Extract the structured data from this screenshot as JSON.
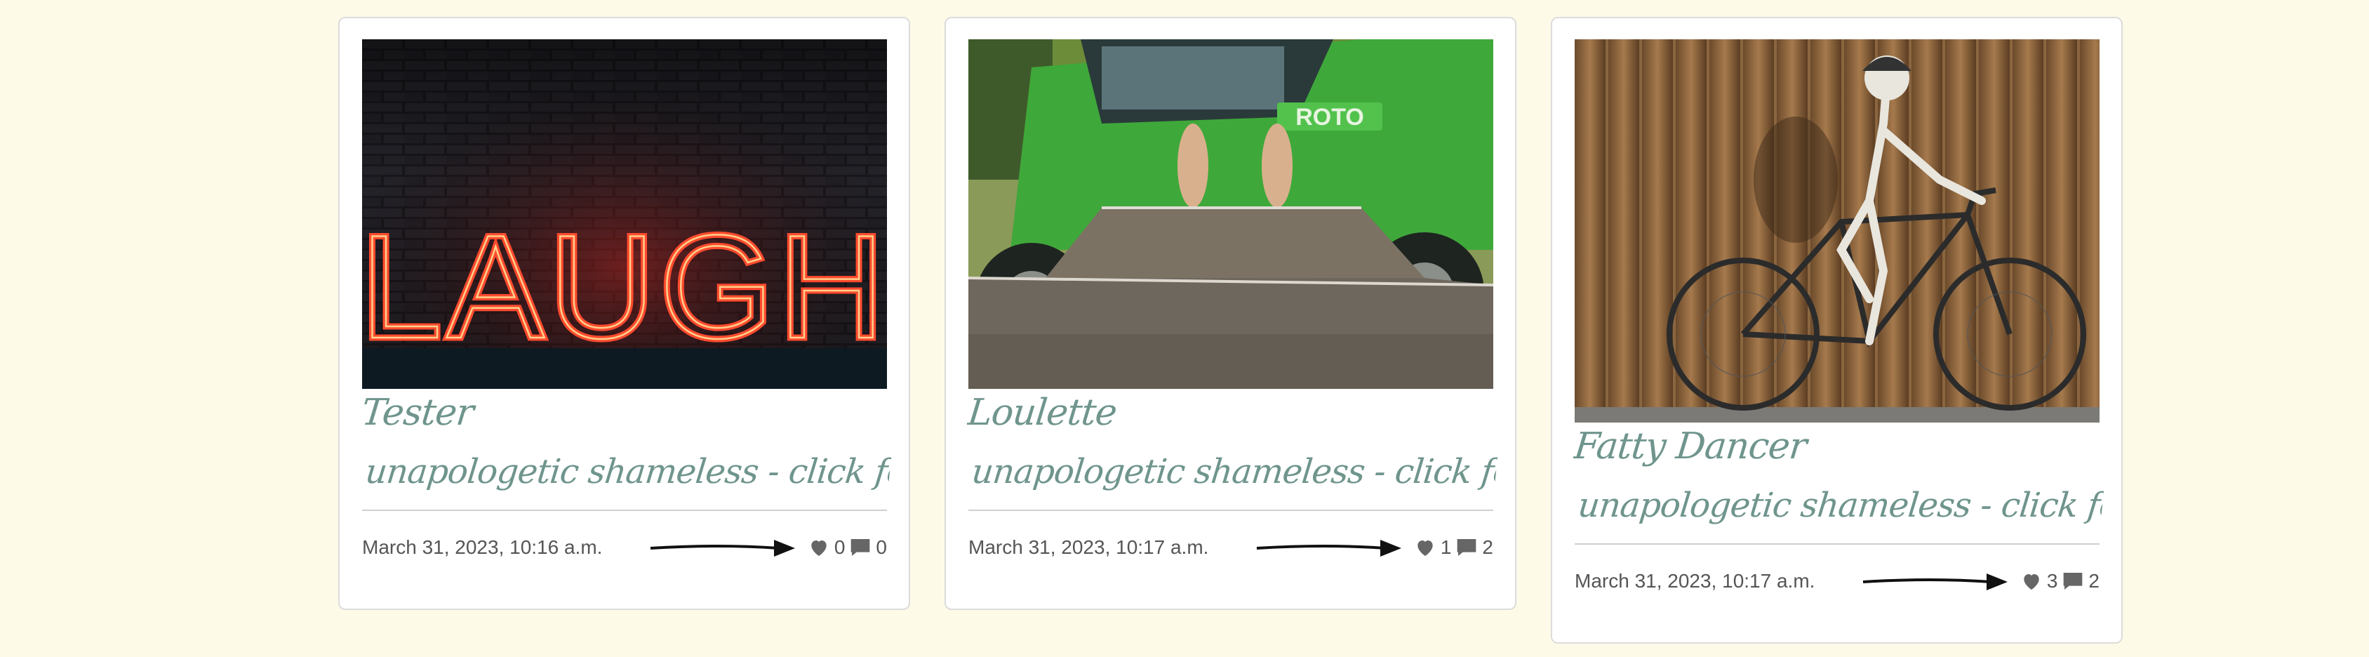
{
  "posts": [
    {
      "image_desc": "neon-sign-laugh",
      "title": "Tester",
      "link": "unapologetic shameless - click for more",
      "date": "March 31, 2023, 10:16 a.m.",
      "likes": "0",
      "comments": "0"
    },
    {
      "image_desc": "green-tractor-feet",
      "title": "Loulette",
      "link": "unapologetic shameless - click for more",
      "date": "March 31, 2023, 10:17 a.m.",
      "likes": "1",
      "comments": "2"
    },
    {
      "image_desc": "skeleton-on-bicycle",
      "title": "Fatty Dancer",
      "link": "unapologetic shameless - click for more",
      "date": "March 31, 2023, 10:17 a.m.",
      "likes": "3",
      "comments": "2"
    }
  ],
  "neon_text": "LAUGH",
  "tractor_label": "ROTO",
  "colors": {
    "page_bg": "#fdfae8",
    "card_bg": "#ffffff",
    "title": "#6f958d",
    "meta_text": "#555555",
    "icon": "#666666"
  },
  "icons": {
    "like": "heart-icon",
    "comment": "comment-icon",
    "arrow": "arrow-right-icon"
  }
}
